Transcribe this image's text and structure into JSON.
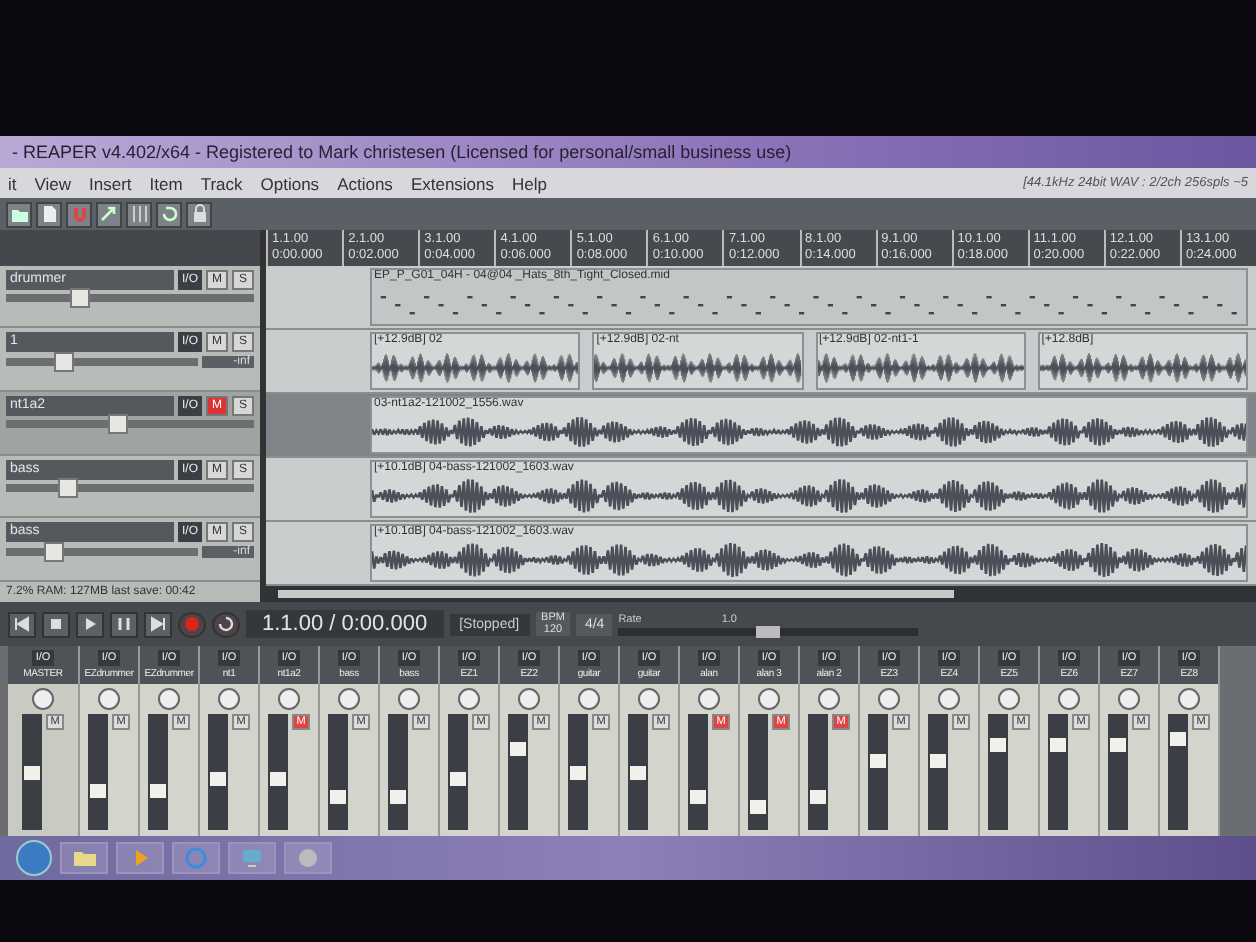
{
  "window": {
    "title": "- REAPER v4.402/x64 - Registered to Mark christesen (Licensed for personal/small business use)"
  },
  "menu": [
    "it",
    "View",
    "Insert",
    "Item",
    "Track",
    "Options",
    "Actions",
    "Extensions",
    "Help"
  ],
  "status": "[44.1kHz 24bit WAV : 2/2ch 256spls ~5",
  "ruler": [
    {
      "measure": "1.1.00",
      "time": "0:00.000"
    },
    {
      "measure": "2.1.00",
      "time": "0:02.000"
    },
    {
      "measure": "3.1.00",
      "time": "0:04.000"
    },
    {
      "measure": "4.1.00",
      "time": "0:06.000"
    },
    {
      "measure": "5.1.00",
      "time": "0:08.000"
    },
    {
      "measure": "6.1.00",
      "time": "0:10.000"
    },
    {
      "measure": "7.1.00",
      "time": "0:12.000"
    },
    {
      "measure": "8.1.00",
      "time": "0:14.000"
    },
    {
      "measure": "9.1.00",
      "time": "0:16.000"
    },
    {
      "measure": "10.1.00",
      "time": "0:18.000"
    },
    {
      "measure": "11.1.00",
      "time": "0:20.000"
    },
    {
      "measure": "12.1.00",
      "time": "0:22.000"
    },
    {
      "measure": "13.1.00",
      "time": "0:24.000"
    }
  ],
  "tracks": [
    {
      "name": "drummer",
      "io": "I/O",
      "mute": "M",
      "solo": "S",
      "muted": false,
      "selected": false,
      "level": 0.3,
      "items": [
        {
          "kind": "midi",
          "label": "EP_P_G01_04H - 04@04 _Hats_8th_Tight_Closed.mid"
        }
      ]
    },
    {
      "name": "1",
      "io": "I/O",
      "mute": "M",
      "solo": "S",
      "muted": false,
      "selected": false,
      "level": 0.3,
      "readout": "-inf",
      "items": [
        {
          "kind": "audio",
          "label": "[+12.9dB] 02"
        },
        {
          "kind": "audio",
          "label": "[+12.9dB] 02-nt"
        },
        {
          "kind": "audio",
          "label": "[+12.9dB] 02-nt1-1"
        },
        {
          "kind": "audio",
          "label": "[+12.8dB]"
        }
      ]
    },
    {
      "name": "nt1a2",
      "io": "I/O",
      "mute": "M",
      "solo": "S",
      "muted": true,
      "selected": true,
      "level": 0.45,
      "items": [
        {
          "kind": "audio",
          "label": "03-nt1a2-121002_1556.wav"
        }
      ]
    },
    {
      "name": "bass",
      "io": "I/O",
      "mute": "M",
      "solo": "S",
      "muted": false,
      "selected": false,
      "level": 0.25,
      "items": [
        {
          "kind": "audio",
          "label": "[+10.1dB] 04-bass-121002_1603.wav"
        }
      ]
    },
    {
      "name": "bass",
      "io": "I/O",
      "mute": "M",
      "solo": "S",
      "muted": false,
      "selected": false,
      "level": 0.25,
      "readout": "-inf",
      "items": [
        {
          "kind": "audio",
          "label": "[+10.1dB] 04-bass-121002_1603.wav"
        }
      ]
    }
  ],
  "performance": "7.2%  RAM: 127MB  last save: 00:42",
  "transport": {
    "position": "1.1.00 / 0:00.000",
    "state": "[Stopped]",
    "bpm_label": "BPM",
    "bpm": "120",
    "signature": "4/4",
    "rate_label": "Rate",
    "rate": "1.0",
    "level": 0.5
  },
  "mixer": [
    {
      "name": "MASTER",
      "io": "I/O",
      "mute": "M",
      "muted": false,
      "level": 0.5
    },
    {
      "name": "EZdrummer",
      "io": "I/O",
      "mute": "M",
      "muted": false,
      "level": 0.35
    },
    {
      "name": "EZdrummer",
      "io": "I/O",
      "mute": "M",
      "muted": false,
      "level": 0.35
    },
    {
      "name": "nt1",
      "io": "I/O",
      "mute": "M",
      "muted": false,
      "level": 0.45
    },
    {
      "name": "nt1a2",
      "io": "I/O",
      "mute": "M",
      "muted": true,
      "level": 0.45
    },
    {
      "name": "bass",
      "io": "I/O",
      "mute": "M",
      "muted": false,
      "level": 0.3
    },
    {
      "name": "bass",
      "io": "I/O",
      "mute": "M",
      "muted": false,
      "level": 0.3
    },
    {
      "name": "EZ1",
      "io": "I/O",
      "mute": "M",
      "muted": false,
      "level": 0.45
    },
    {
      "name": "EZ2",
      "io": "I/O",
      "mute": "M",
      "muted": false,
      "level": 0.7
    },
    {
      "name": "guitar",
      "io": "I/O",
      "mute": "M",
      "muted": false,
      "level": 0.5
    },
    {
      "name": "guitar",
      "io": "I/O",
      "mute": "M",
      "muted": false,
      "level": 0.5
    },
    {
      "name": "alan",
      "io": "I/O",
      "mute": "M",
      "muted": true,
      "level": 0.3
    },
    {
      "name": "alan 3",
      "io": "I/O",
      "mute": "M",
      "muted": true,
      "level": 0.2
    },
    {
      "name": "alan 2",
      "io": "I/O",
      "mute": "M",
      "muted": true,
      "level": 0.3
    },
    {
      "name": "EZ3",
      "io": "I/O",
      "mute": "M",
      "muted": false,
      "level": 0.6
    },
    {
      "name": "EZ4",
      "io": "I/O",
      "mute": "M",
      "muted": false,
      "level": 0.6
    },
    {
      "name": "EZ5",
      "io": "I/O",
      "mute": "M",
      "muted": false,
      "level": 0.75
    },
    {
      "name": "EZ6",
      "io": "I/O",
      "mute": "M",
      "muted": false,
      "level": 0.75
    },
    {
      "name": "EZ7",
      "io": "I/O",
      "mute": "M",
      "muted": false,
      "level": 0.75
    },
    {
      "name": "EZ8",
      "io": "I/O",
      "mute": "M",
      "muted": false,
      "level": 0.8
    }
  ]
}
